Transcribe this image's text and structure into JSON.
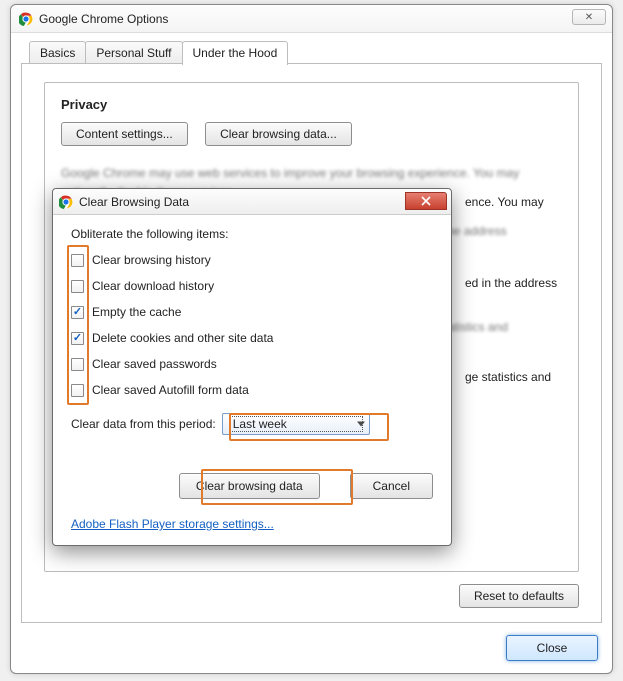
{
  "main_window": {
    "title": "Google Chrome Options",
    "tabs": [
      "Basics",
      "Personal Stuff",
      "Under the Hood"
    ],
    "active_tab": 2,
    "privacy_section": {
      "title": "Privacy",
      "content_settings_btn": "Content settings...",
      "clear_browsing_btn": "Clear browsing data..."
    },
    "partial_text": {
      "tail1": "ence. You may",
      "tail2": "ed in the address",
      "tail3": "ge statistics and"
    },
    "reset_btn": "Reset to defaults",
    "close_btn": "Close"
  },
  "modal": {
    "title": "Clear Browsing Data",
    "prompt": "Obliterate the following items:",
    "items": [
      {
        "label": "Clear browsing history",
        "checked": false
      },
      {
        "label": "Clear download history",
        "checked": false
      },
      {
        "label": "Empty the cache",
        "checked": true
      },
      {
        "label": "Delete cookies and other site data",
        "checked": true
      },
      {
        "label": "Clear saved passwords",
        "checked": false
      },
      {
        "label": "Clear saved Autofill form data",
        "checked": false
      }
    ],
    "period_label": "Clear data from this period:",
    "period_value": "Last week",
    "clear_btn": "Clear browsing data",
    "cancel_btn": "Cancel",
    "flash_link": "Adobe Flash Player storage settings..."
  }
}
